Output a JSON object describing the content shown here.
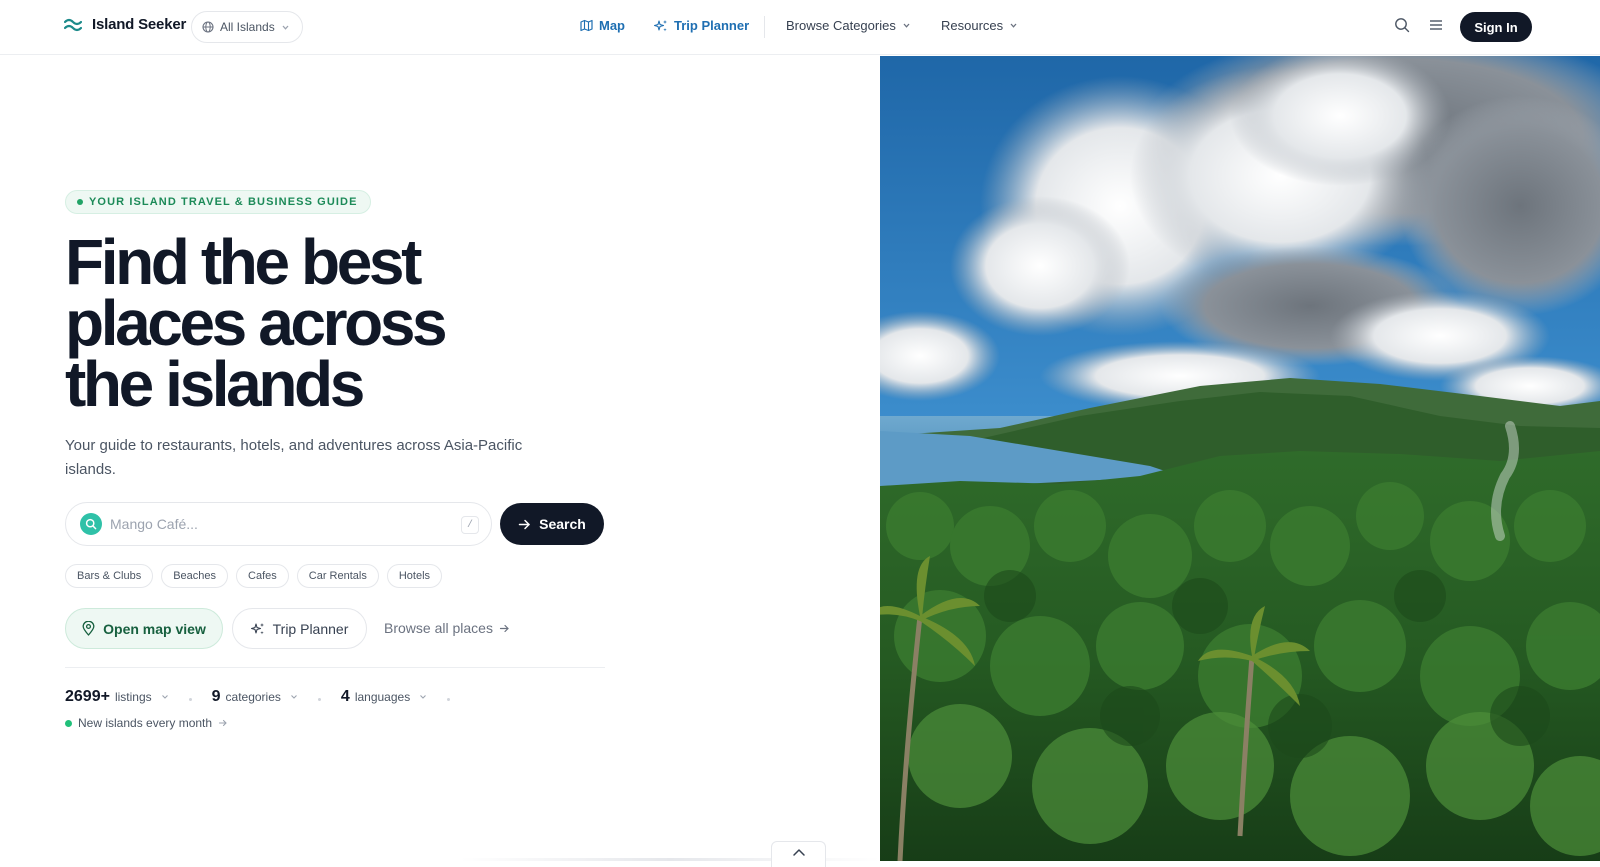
{
  "header": {
    "brand": "Island Seeker",
    "island_select": "All Islands",
    "nav": {
      "map": "Map",
      "trip_planner": "Trip Planner",
      "browse_categories": "Browse Categories",
      "resources": "Resources"
    },
    "sign_in": "Sign In"
  },
  "hero": {
    "eyebrow": "YOUR ISLAND TRAVEL & BUSINESS GUIDE",
    "title_line1": "Find the best",
    "title_line2": "places across",
    "title_line3": "the islands",
    "subtitle": "Your guide to restaurants, hotels, and adventures across Asia-Pacific islands.",
    "search": {
      "placeholder": "Mango Café...",
      "shortcut": "/",
      "button": "Search"
    },
    "chips": [
      "Bars & Clubs",
      "Beaches",
      "Cafes",
      "Car Rentals",
      "Hotels"
    ],
    "actions": {
      "open_map": "Open map view",
      "trip_planner": "Trip Planner",
      "browse_all": "Browse all places"
    },
    "stats": [
      {
        "value": "2699+",
        "label": "listings"
      },
      {
        "value": "9",
        "label": "categories"
      },
      {
        "value": "4",
        "label": "languages"
      }
    ],
    "new_islands": "New islands every month"
  },
  "icons": {
    "logo": "waves-icon",
    "island_select": "globe-icon",
    "map": "map-icon",
    "trip": "sparkles-icon",
    "search": "search-icon",
    "menu": "menu-icon",
    "arrow": "arrow-right-icon",
    "pin": "map-pin-icon",
    "scroll": "chevron-up-icon"
  },
  "colors": {
    "primary_dark": "#111827",
    "nav_accent": "#1f6fb2",
    "green_accent": "#21a366",
    "search_badge": "#2fc1a8"
  }
}
